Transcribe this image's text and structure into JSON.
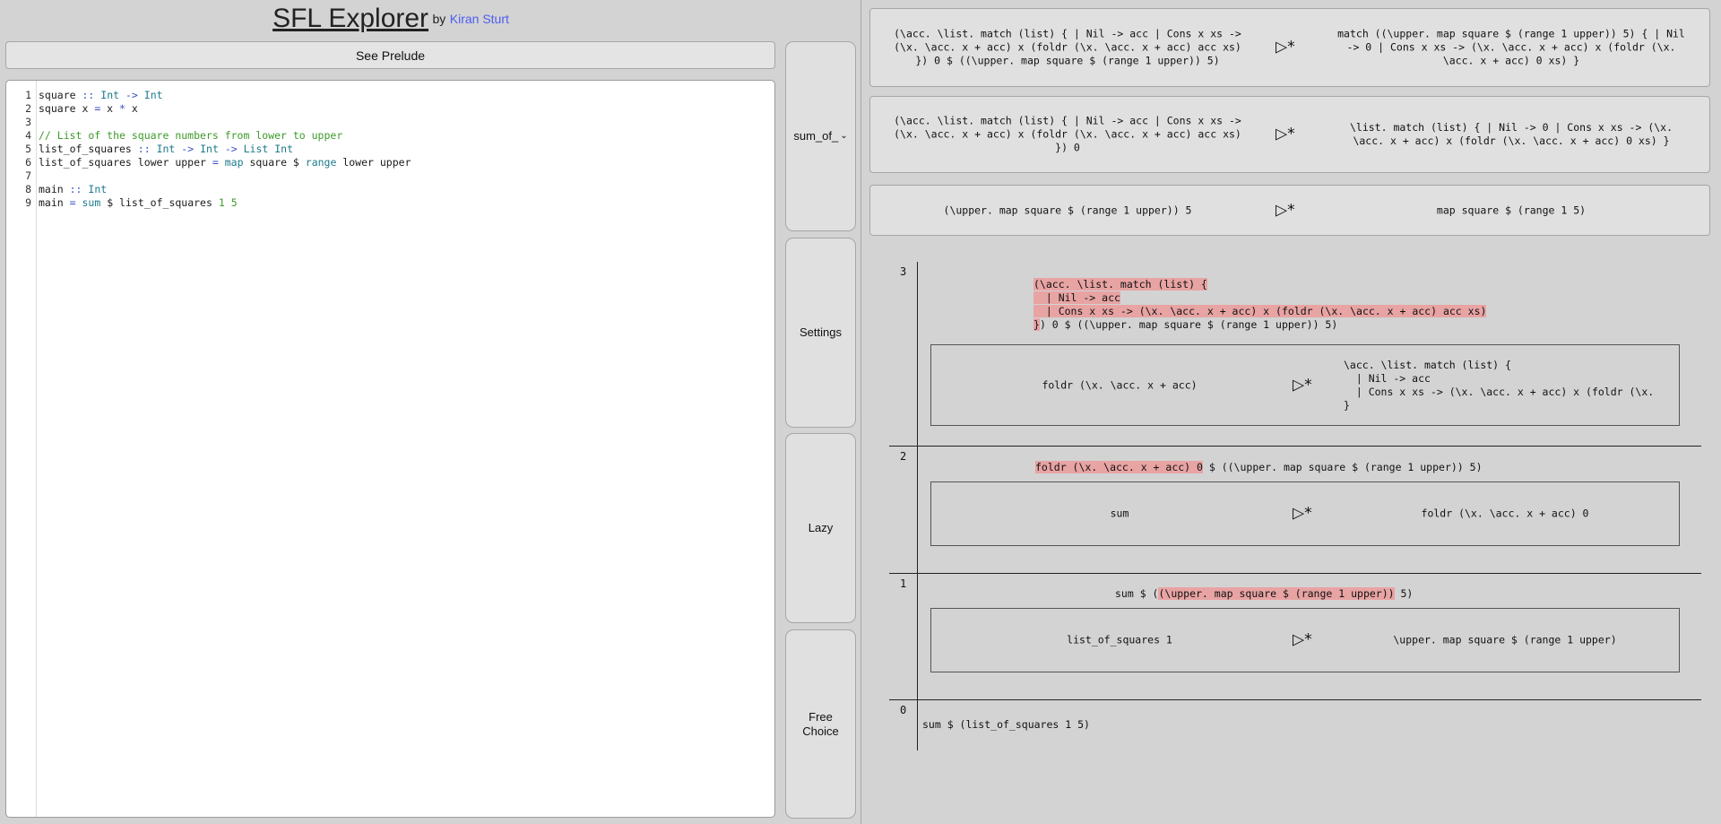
{
  "header": {
    "title": "SFL Explorer",
    "by": "by",
    "author": "Kiran Sturt"
  },
  "prelude_button": "See Prelude",
  "editor": {
    "lines": [
      {
        "num": "1",
        "tokens": [
          {
            "t": "square ",
            "c": ""
          },
          {
            "t": "::",
            "c": "tk-op"
          },
          {
            "t": " ",
            "c": ""
          },
          {
            "t": "Int",
            "c": "tk-type"
          },
          {
            "t": " ",
            "c": ""
          },
          {
            "t": "->",
            "c": "tk-op"
          },
          {
            "t": " ",
            "c": ""
          },
          {
            "t": "Int",
            "c": "tk-type"
          }
        ]
      },
      {
        "num": "2",
        "tokens": [
          {
            "t": "square x ",
            "c": ""
          },
          {
            "t": "=",
            "c": "tk-op"
          },
          {
            "t": " x ",
            "c": ""
          },
          {
            "t": "*",
            "c": "tk-op"
          },
          {
            "t": " x",
            "c": ""
          }
        ]
      },
      {
        "num": "3",
        "tokens": []
      },
      {
        "num": "4",
        "tokens": [
          {
            "t": "// List of the square numbers from lower to upper",
            "c": "tk-comment"
          }
        ]
      },
      {
        "num": "5",
        "tokens": [
          {
            "t": "list_of_squares ",
            "c": ""
          },
          {
            "t": "::",
            "c": "tk-op"
          },
          {
            "t": " ",
            "c": ""
          },
          {
            "t": "Int",
            "c": "tk-type"
          },
          {
            "t": " ",
            "c": ""
          },
          {
            "t": "->",
            "c": "tk-op"
          },
          {
            "t": " ",
            "c": ""
          },
          {
            "t": "Int",
            "c": "tk-type"
          },
          {
            "t": " ",
            "c": ""
          },
          {
            "t": "->",
            "c": "tk-op"
          },
          {
            "t": " ",
            "c": ""
          },
          {
            "t": "List",
            "c": "tk-type"
          },
          {
            "t": " ",
            "c": ""
          },
          {
            "t": "Int",
            "c": "tk-type"
          }
        ]
      },
      {
        "num": "6",
        "tokens": [
          {
            "t": "list_of_squares lower upper ",
            "c": ""
          },
          {
            "t": "=",
            "c": "tk-op"
          },
          {
            "t": " ",
            "c": ""
          },
          {
            "t": "map",
            "c": "tk-fn"
          },
          {
            "t": " square $ ",
            "c": ""
          },
          {
            "t": "range",
            "c": "tk-fn"
          },
          {
            "t": " lower upper",
            "c": ""
          }
        ]
      },
      {
        "num": "7",
        "tokens": []
      },
      {
        "num": "8",
        "tokens": [
          {
            "t": "main ",
            "c": ""
          },
          {
            "t": "::",
            "c": "tk-op"
          },
          {
            "t": " ",
            "c": ""
          },
          {
            "t": "Int",
            "c": "tk-type"
          }
        ]
      },
      {
        "num": "9",
        "tokens": [
          {
            "t": "main ",
            "c": ""
          },
          {
            "t": "=",
            "c": "tk-op"
          },
          {
            "t": " ",
            "c": ""
          },
          {
            "t": "sum",
            "c": "tk-fn"
          },
          {
            "t": " $ list_of_squares ",
            "c": ""
          },
          {
            "t": "1",
            "c": "tk-num"
          },
          {
            "t": " ",
            "c": ""
          },
          {
            "t": "5",
            "c": "tk-num"
          }
        ]
      }
    ]
  },
  "side_buttons": {
    "function_select": "sum_of_",
    "settings": "Settings",
    "lazy": "Lazy",
    "free_choice": "Free\nChoice"
  },
  "arrow_symbol": "▷*",
  "rules": [
    {
      "lhs": "(\\acc. \\list. match (list) { | Nil -> acc | Cons x xs ->\n(\\x. \\acc. x + acc) x (foldr (\\x. \\acc. x + acc) acc xs)\n}) 0 $ ((\\upper. map square $ (range 1 upper)) 5)",
      "rhs": "match ((\\upper. map square $ (range 1 upper)) 5) { | Nil\n-> 0 | Cons x xs -> (\\x. \\acc. x + acc) x (foldr (\\x.\n\\acc. x + acc) 0 xs) }"
    },
    {
      "lhs": "(\\acc. \\list. match (list) { | Nil -> acc | Cons x xs ->\n(\\x. \\acc. x + acc) x (foldr (\\x. \\acc. x + acc) acc xs)\n}) 0",
      "rhs": "\\list. match (list) { | Nil -> 0 | Cons x xs -> (\\x.\n\\acc. x + acc) x (foldr (\\x. \\acc. x + acc) 0 xs) }"
    },
    {
      "lhs": "(\\upper. map square $ (range 1 upper)) 5",
      "rhs": "map square $ (range 1 5)"
    }
  ],
  "steps": [
    {
      "num": "3",
      "expr_hl": "(\\acc. \\list. match (list) {\n  | Nil -> acc\n  | Cons x xs -> (\\x. \\acc. x + acc) x (foldr (\\x. \\acc. x + acc) acc xs)\n}",
      "expr_after": ") 0 $ ((\\upper. map square $ (range 1 upper)) 5)",
      "sub_lhs": "foldr (\\x. \\acc. x + acc)",
      "sub_rhs": "\\acc. \\list. match (list) {\n  | Nil -> acc\n  | Cons x xs -> (\\x. \\acc. x + acc) x (foldr (\\x.\n}"
    },
    {
      "num": "2",
      "expr_hl": "foldr (\\x. \\acc. x + acc) 0",
      "expr_after": " $ ((\\upper. map square $ (range 1 upper)) 5)",
      "sub_lhs": "sum",
      "sub_rhs": "foldr (\\x. \\acc. x + acc) 0"
    },
    {
      "num": "1",
      "expr_before": "sum $ (",
      "expr_hl": "(\\upper. map square $ (range 1 upper))",
      "expr_after": " 5)",
      "sub_lhs": "list_of_squares 1",
      "sub_rhs": "\\upper. map square $ (range 1 upper)"
    },
    {
      "num": "0",
      "expr": "sum $ (list_of_squares 1 5)"
    }
  ]
}
